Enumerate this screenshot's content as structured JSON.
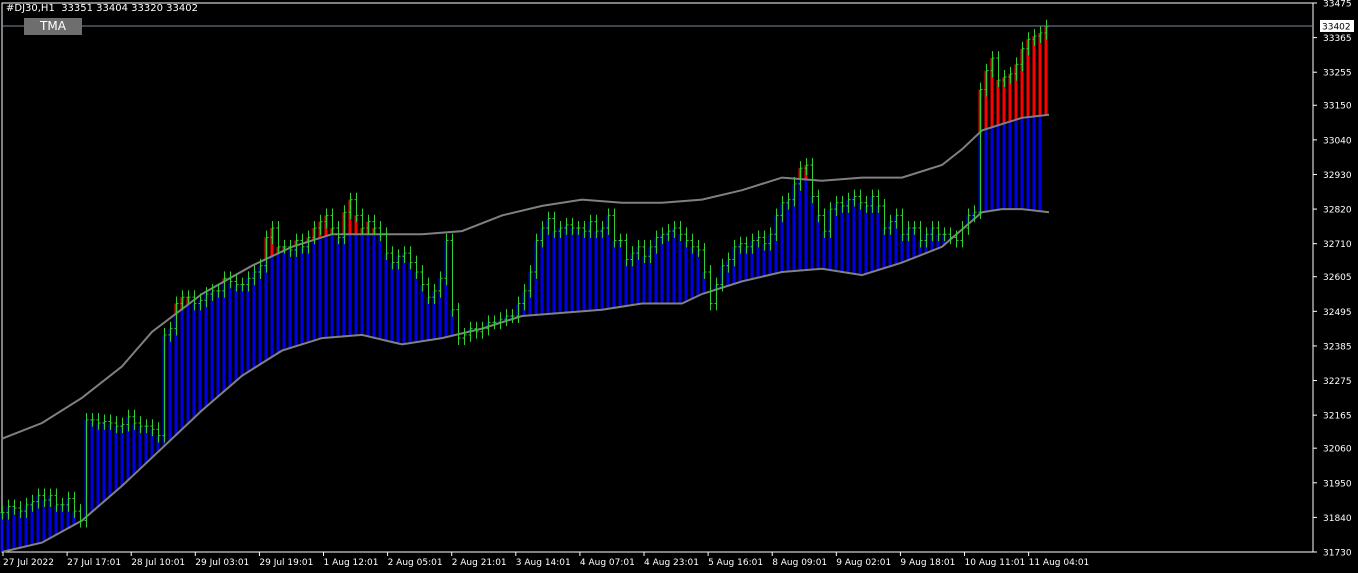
{
  "header": {
    "symbol": "#DJ30,H1",
    "ohlc": "33351 33404 33320 33402"
  },
  "indicator_button": {
    "label": "TMA"
  },
  "price_tag": {
    "value": "33402"
  },
  "colors": {
    "background": "#000000",
    "candle": "#32cd32",
    "bands": "#808080",
    "upper_fill": "#ff0000",
    "lower_fill": "#0000ff",
    "axis": "#ffffff",
    "bid_line": "#778899"
  },
  "chart_data": {
    "type": "line",
    "title": "",
    "instrument": "#DJ30",
    "timeframe": "H1",
    "ylim": [
      31730,
      33475
    ],
    "y_ticks": [
      33475,
      33365,
      33255,
      33150,
      33040,
      32930,
      32820,
      32710,
      32605,
      32495,
      32385,
      32275,
      32165,
      32060,
      31950,
      31840,
      31730
    ],
    "x_ticks": [
      "27 Jul 2022",
      "27 Jul 17:01",
      "28 Jul 10:01",
      "29 Jul 03:01",
      "29 Jul 19:01",
      "1 Aug 12:01",
      "2 Aug 05:01",
      "2 Aug 21:01",
      "3 Aug 14:01",
      "4 Aug 07:01",
      "4 Aug 23:01",
      "5 Aug 16:01",
      "8 Aug 09:01",
      "9 Aug 02:01",
      "9 Aug 18:01",
      "10 Aug 11:01",
      "11 Aug 04:01"
    ],
    "last_price": 33402,
    "grid": false,
    "series": [
      {
        "type": "candle_close",
        "points": [
          [
            0,
            31855
          ],
          [
            6,
            31875
          ],
          [
            12,
            31870
          ],
          [
            18,
            31860
          ],
          [
            24,
            31880
          ],
          [
            30,
            31890
          ],
          [
            36,
            31910
          ],
          [
            42,
            31895
          ],
          [
            48,
            31910
          ],
          [
            54,
            31880
          ],
          [
            60,
            31880
          ],
          [
            66,
            31900
          ],
          [
            72,
            31860
          ],
          [
            78,
            31830
          ],
          [
            84,
            32150
          ],
          [
            90,
            32150
          ],
          [
            96,
            32140
          ],
          [
            102,
            32145
          ],
          [
            108,
            32140
          ],
          [
            114,
            32130
          ],
          [
            120,
            32135
          ],
          [
            126,
            32160
          ],
          [
            132,
            32140
          ],
          [
            138,
            32130
          ],
          [
            144,
            32130
          ],
          [
            150,
            32120
          ],
          [
            156,
            32100
          ],
          [
            162,
            32420
          ],
          [
            168,
            32440
          ],
          [
            174,
            32520
          ],
          [
            180,
            32540
          ],
          [
            186,
            32540
          ],
          [
            192,
            32520
          ],
          [
            198,
            32530
          ],
          [
            204,
            32550
          ],
          [
            210,
            32560
          ],
          [
            216,
            32560
          ],
          [
            222,
            32600
          ],
          [
            228,
            32590
          ],
          [
            234,
            32580
          ],
          [
            240,
            32580
          ],
          [
            246,
            32600
          ],
          [
            252,
            32620
          ],
          [
            258,
            32640
          ],
          [
            264,
            32730
          ],
          [
            270,
            32760
          ],
          [
            276,
            32700
          ],
          [
            282,
            32700
          ],
          [
            288,
            32690
          ],
          [
            294,
            32720
          ],
          [
            300,
            32700
          ],
          [
            306,
            32730
          ],
          [
            312,
            32760
          ],
          [
            318,
            32780
          ],
          [
            324,
            32800
          ],
          [
            330,
            32760
          ],
          [
            336,
            32730
          ],
          [
            342,
            32810
          ],
          [
            348,
            32850
          ],
          [
            354,
            32800
          ],
          [
            360,
            32760
          ],
          [
            366,
            32780
          ],
          [
            372,
            32760
          ],
          [
            378,
            32740
          ],
          [
            384,
            32680
          ],
          [
            390,
            32650
          ],
          [
            396,
            32670
          ],
          [
            402,
            32680
          ],
          [
            408,
            32650
          ],
          [
            414,
            32620
          ],
          [
            420,
            32580
          ],
          [
            426,
            32540
          ],
          [
            432,
            32560
          ],
          [
            438,
            32600
          ],
          [
            444,
            32720
          ],
          [
            450,
            32500
          ],
          [
            456,
            32410
          ],
          [
            462,
            32420
          ],
          [
            468,
            32440
          ],
          [
            474,
            32430
          ],
          [
            480,
            32440
          ],
          [
            486,
            32460
          ],
          [
            492,
            32460
          ],
          [
            498,
            32470
          ],
          [
            504,
            32480
          ],
          [
            510,
            32480
          ],
          [
            516,
            32520
          ],
          [
            522,
            32560
          ],
          [
            528,
            32620
          ],
          [
            534,
            32720
          ],
          [
            540,
            32760
          ],
          [
            546,
            32790
          ],
          [
            552,
            32750
          ],
          [
            558,
            32760
          ],
          [
            564,
            32770
          ],
          [
            570,
            32760
          ],
          [
            576,
            32760
          ],
          [
            582,
            32750
          ],
          [
            588,
            32780
          ],
          [
            594,
            32750
          ],
          [
            600,
            32760
          ],
          [
            606,
            32800
          ],
          [
            612,
            32720
          ],
          [
            618,
            32720
          ],
          [
            624,
            32660
          ],
          [
            630,
            32680
          ],
          [
            636,
            32700
          ],
          [
            642,
            32670
          ],
          [
            648,
            32700
          ],
          [
            654,
            32730
          ],
          [
            660,
            32740
          ],
          [
            666,
            32750
          ],
          [
            672,
            32760
          ],
          [
            678,
            32740
          ],
          [
            684,
            32720
          ],
          [
            690,
            32700
          ],
          [
            696,
            32690
          ],
          [
            702,
            32620
          ],
          [
            708,
            32520
          ],
          [
            714,
            32580
          ],
          [
            720,
            32640
          ],
          [
            726,
            32660
          ],
          [
            732,
            32700
          ],
          [
            738,
            32710
          ],
          [
            744,
            32700
          ],
          [
            750,
            32720
          ],
          [
            756,
            32730
          ],
          [
            762,
            32710
          ],
          [
            768,
            32740
          ],
          [
            774,
            32800
          ],
          [
            780,
            32840
          ],
          [
            786,
            32850
          ],
          [
            792,
            32900
          ],
          [
            798,
            32950
          ],
          [
            804,
            32960
          ],
          [
            810,
            32860
          ],
          [
            816,
            32800
          ],
          [
            822,
            32750
          ],
          [
            828,
            32820
          ],
          [
            834,
            32840
          ],
          [
            840,
            32830
          ],
          [
            846,
            32850
          ],
          [
            852,
            32860
          ],
          [
            858,
            32840
          ],
          [
            864,
            32830
          ],
          [
            870,
            32860
          ],
          [
            876,
            32830
          ],
          [
            882,
            32760
          ],
          [
            888,
            32780
          ],
          [
            894,
            32800
          ],
          [
            900,
            32740
          ],
          [
            906,
            32760
          ],
          [
            912,
            32760
          ],
          [
            918,
            32720
          ],
          [
            924,
            32740
          ],
          [
            930,
            32760
          ],
          [
            936,
            32740
          ],
          [
            942,
            32740
          ],
          [
            948,
            32730
          ],
          [
            954,
            32720
          ],
          [
            960,
            32760
          ],
          [
            966,
            32800
          ],
          [
            972,
            32810
          ],
          [
            978,
            33200
          ],
          [
            984,
            33260
          ],
          [
            990,
            33300
          ],
          [
            996,
            33230
          ],
          [
            1002,
            33240
          ],
          [
            1008,
            33250
          ],
          [
            1014,
            33280
          ],
          [
            1020,
            33330
          ],
          [
            1026,
            33360
          ],
          [
            1032,
            33370
          ],
          [
            1038,
            33380
          ],
          [
            1044,
            33400
          ]
        ]
      },
      {
        "name": "",
        "type": "upper_band",
        "points": [
          [
            0,
            32090
          ],
          [
            40,
            32140
          ],
          [
            80,
            32220
          ],
          [
            120,
            32320
          ],
          [
            150,
            32430
          ],
          [
            200,
            32550
          ],
          [
            250,
            32640
          ],
          [
            290,
            32700
          ],
          [
            330,
            32740
          ],
          [
            380,
            32740
          ],
          [
            420,
            32740
          ],
          [
            460,
            32750
          ],
          [
            500,
            32800
          ],
          [
            540,
            32830
          ],
          [
            580,
            32850
          ],
          [
            620,
            32840
          ],
          [
            660,
            32840
          ],
          [
            700,
            32850
          ],
          [
            740,
            32880
          ],
          [
            780,
            32920
          ],
          [
            820,
            32910
          ],
          [
            860,
            32920
          ],
          [
            900,
            32920
          ],
          [
            940,
            32960
          ],
          [
            960,
            33010
          ],
          [
            980,
            33070
          ],
          [
            1000,
            33090
          ],
          [
            1020,
            33110
          ],
          [
            1047,
            33120
          ]
        ]
      },
      {
        "name": "",
        "type": "middle_band",
        "points": [
          [
            0,
            31730
          ],
          [
            40,
            31760
          ],
          [
            80,
            31830
          ],
          [
            120,
            31940
          ],
          [
            160,
            32060
          ],
          [
            200,
            32180
          ],
          [
            240,
            32290
          ],
          [
            280,
            32370
          ],
          [
            320,
            32410
          ],
          [
            360,
            32420
          ],
          [
            400,
            32390
          ],
          [
            440,
            32410
          ],
          [
            480,
            32440
          ],
          [
            520,
            32480
          ],
          [
            560,
            32490
          ],
          [
            600,
            32500
          ],
          [
            640,
            32520
          ],
          [
            680,
            32520
          ],
          [
            700,
            32550
          ],
          [
            740,
            32590
          ],
          [
            780,
            32620
          ],
          [
            820,
            32630
          ],
          [
            860,
            32610
          ],
          [
            900,
            32650
          ],
          [
            940,
            32700
          ],
          [
            980,
            32810
          ],
          [
            1000,
            32820
          ],
          [
            1020,
            32820
          ],
          [
            1047,
            32810
          ]
        ]
      },
      {
        "name": "",
        "type": "lower_band",
        "points": [
          [
            320,
            32410
          ],
          [
            360,
            32420
          ],
          [
            400,
            32390
          ],
          [
            440,
            32410
          ],
          [
            480,
            32440
          ],
          [
            520,
            32480
          ],
          [
            560,
            32490
          ],
          [
            600,
            32500
          ],
          [
            640,
            32520
          ],
          [
            680,
            32520
          ],
          [
            700,
            32550
          ],
          [
            740,
            32590
          ],
          [
            780,
            32620
          ],
          [
            820,
            32630
          ],
          [
            860,
            32610
          ],
          [
            900,
            32650
          ],
          [
            940,
            32700
          ],
          [
            980,
            32810
          ],
          [
            1000,
            32820
          ],
          [
            1020,
            32820
          ],
          [
            1047,
            32810
          ]
        ]
      }
    ]
  }
}
